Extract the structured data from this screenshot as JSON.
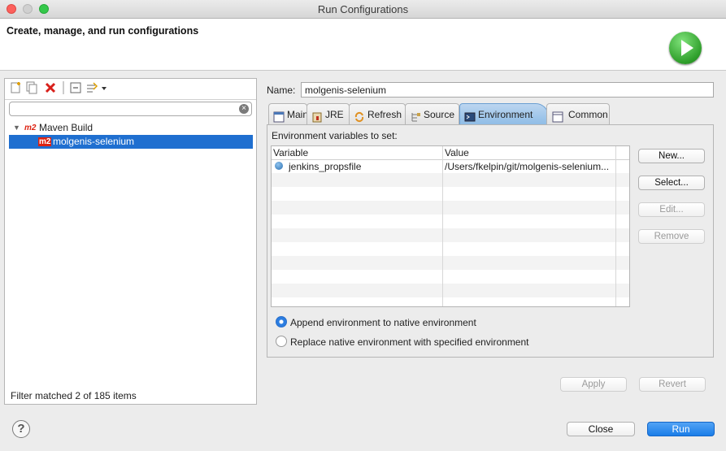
{
  "window": {
    "title": "Run Configurations"
  },
  "header": {
    "title": "Create, manage, and run configurations"
  },
  "left": {
    "filter_placeholder": "",
    "tree": [
      {
        "label": "Maven Build",
        "badge": "m2"
      },
      {
        "label": "molgenis-selenium",
        "badge": "m2"
      }
    ],
    "filter_info": "Filter matched 2 of 185 items"
  },
  "config": {
    "name_label": "Name:",
    "name_value": "molgenis-selenium",
    "tabs": [
      {
        "label": "Main",
        "icon": "main-tab-icon"
      },
      {
        "label": "JRE",
        "icon": "jre-icon"
      },
      {
        "label": "Refresh",
        "icon": "refresh-icon"
      },
      {
        "label": "Source",
        "icon": "source-icon"
      },
      {
        "label": "Environment",
        "icon": "environment-icon"
      },
      {
        "label": "Common",
        "icon": "common-icon"
      }
    ],
    "active_tab": "Environment",
    "env_label": "Environment variables to set:",
    "table": {
      "headers": [
        "Variable",
        "Value"
      ],
      "rows": [
        {
          "variable": "jenkins_propsfile",
          "value": "/Users/fkelpin/git/molgenis-selenium..."
        }
      ]
    },
    "side_buttons": [
      "New...",
      "Select...",
      "Edit...",
      "Remove"
    ],
    "radio_append": "Append environment to native environment",
    "radio_replace": "Replace native environment with specified environment",
    "apply_label": "Apply",
    "revert_label": "Revert"
  },
  "footer": {
    "help": "?",
    "close_label": "Close",
    "run_label": "Run"
  },
  "colors": {
    "selection": "#1f6fd0",
    "run_button": "#1a7de8",
    "active_tab": "#8fbde6"
  }
}
